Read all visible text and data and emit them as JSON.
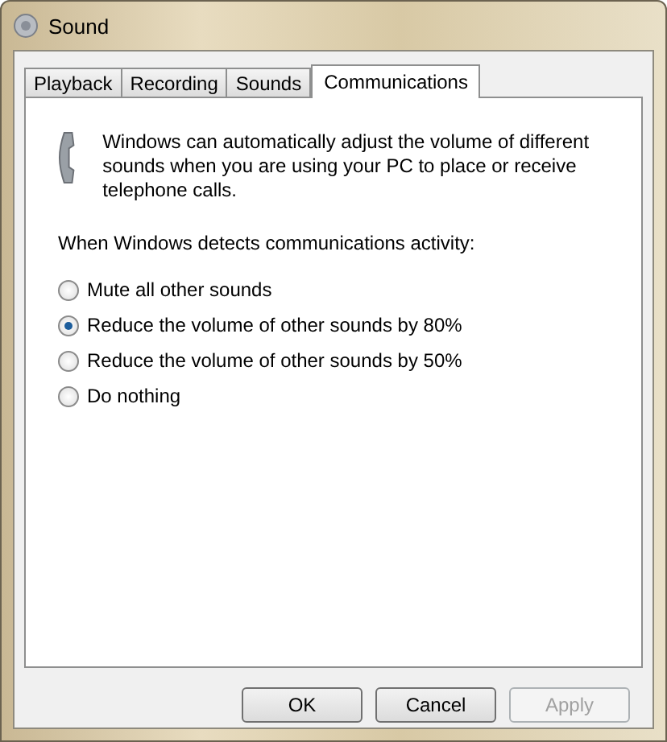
{
  "window": {
    "title": "Sound"
  },
  "tabs": [
    {
      "label": "Playback",
      "selected": false
    },
    {
      "label": "Recording",
      "selected": false
    },
    {
      "label": "Sounds",
      "selected": false
    },
    {
      "label": "Communications",
      "selected": true
    }
  ],
  "description": "Windows can automatically adjust the volume of different sounds when you are using your PC to place or receive telephone calls.",
  "prompt": "When Windows detects communications activity:",
  "options": [
    {
      "label": "Mute all other sounds",
      "selected": false
    },
    {
      "label": "Reduce the volume of other sounds by 80%",
      "selected": true
    },
    {
      "label": "Reduce the volume of other sounds by 50%",
      "selected": false
    },
    {
      "label": "Do nothing",
      "selected": false
    }
  ],
  "buttons": [
    {
      "label": "OK",
      "disabled": false
    },
    {
      "label": "Cancel",
      "disabled": false
    },
    {
      "label": "Apply",
      "disabled": true
    }
  ]
}
